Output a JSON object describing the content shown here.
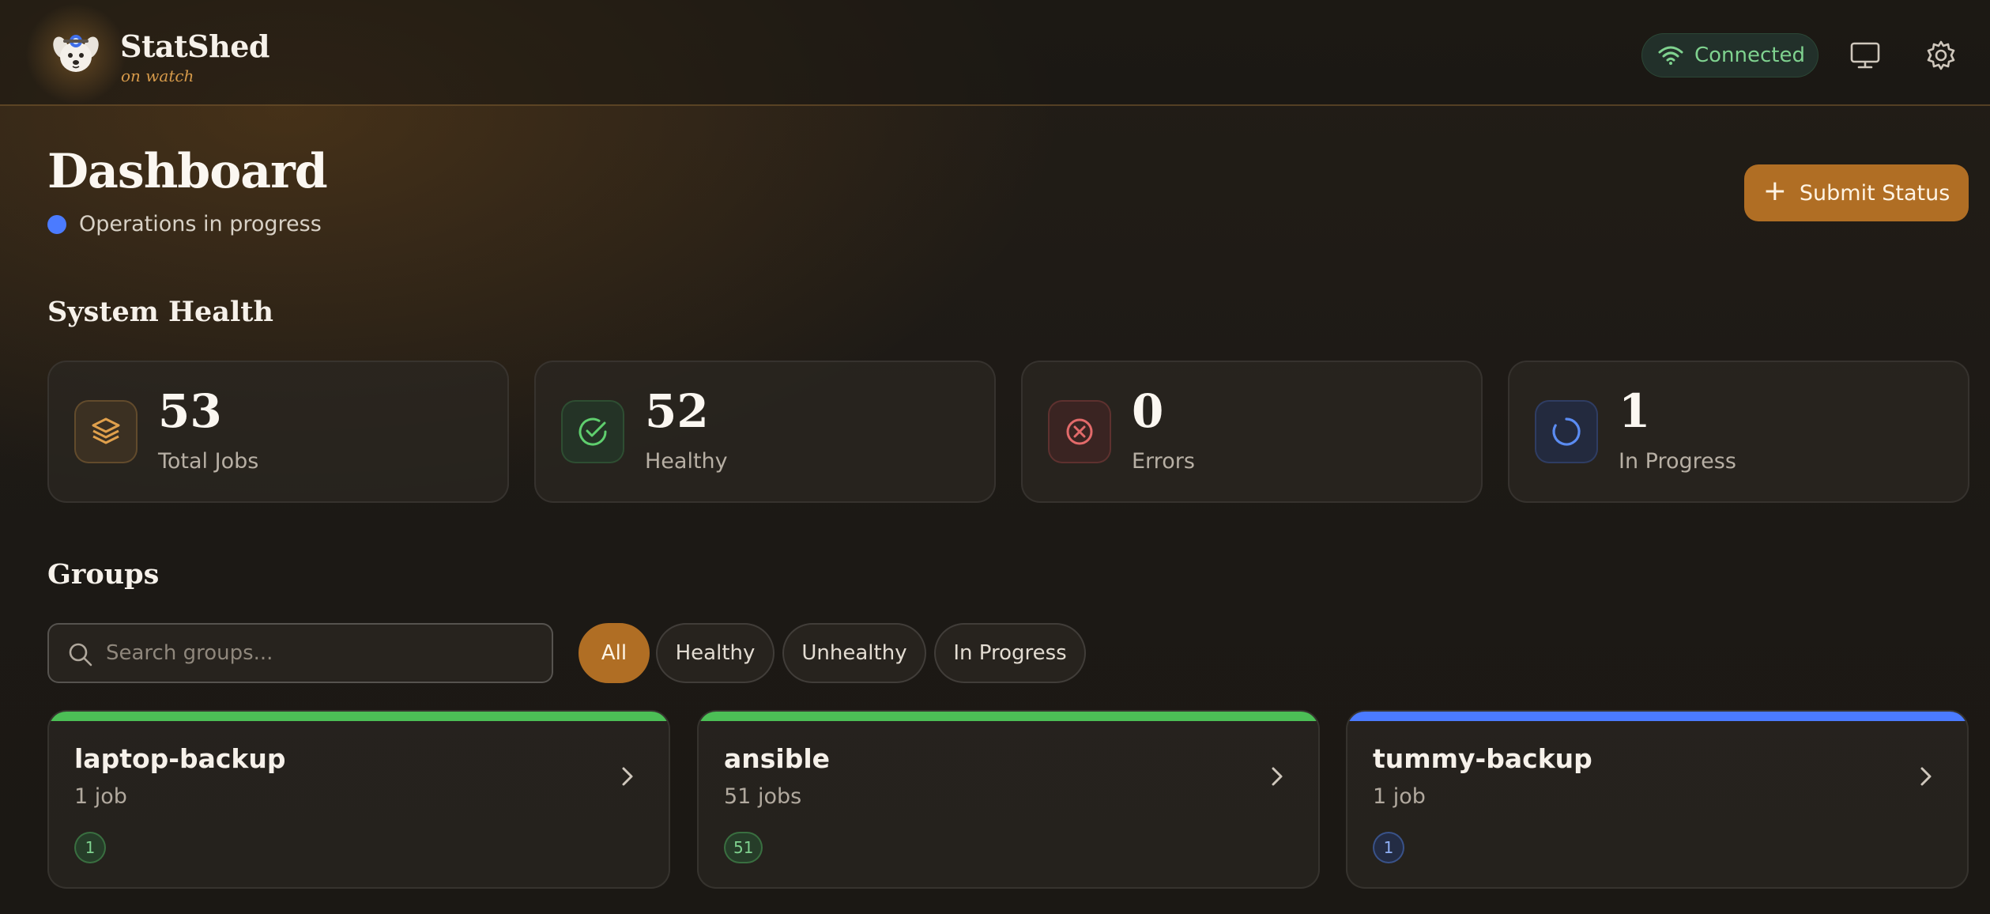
{
  "header": {
    "brand_name": "StatShed",
    "brand_tagline": "on watch",
    "connection_status": "Connected"
  },
  "page": {
    "title": "Dashboard",
    "status_text": "Operations in progress",
    "submit_label": "Submit Status"
  },
  "system_health": {
    "title": "System Health",
    "stats": [
      {
        "value": "53",
        "label": "Total Jobs",
        "icon": "layers-icon"
      },
      {
        "value": "52",
        "label": "Healthy",
        "icon": "check-circle-icon"
      },
      {
        "value": "0",
        "label": "Errors",
        "icon": "x-circle-icon"
      },
      {
        "value": "1",
        "label": "In Progress",
        "icon": "spinner-icon"
      }
    ]
  },
  "groups": {
    "title": "Groups",
    "search_placeholder": "Search groups...",
    "filters": [
      {
        "label": "All",
        "active": true
      },
      {
        "label": "Healthy",
        "active": false
      },
      {
        "label": "Unhealthy",
        "active": false
      },
      {
        "label": "In Progress",
        "active": false
      }
    ],
    "items": [
      {
        "name": "laptop-backup",
        "count": "1 job",
        "badge": "1",
        "status": "healthy"
      },
      {
        "name": "ansible",
        "count": "51 jobs",
        "badge": "51",
        "status": "healthy"
      },
      {
        "name": "tummy-backup",
        "count": "1 job",
        "badge": "1",
        "status": "in-progress"
      }
    ]
  },
  "colors": {
    "accent": "#b06e24",
    "healthy": "#4cbf56",
    "in_progress": "#4b7bff",
    "error": "#e06060"
  }
}
